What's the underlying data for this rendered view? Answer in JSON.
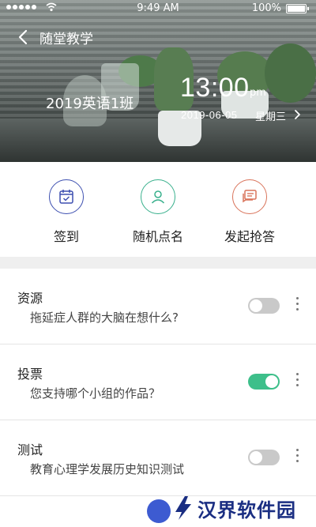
{
  "status_bar": {
    "time": "9:49 AM",
    "battery": "100%"
  },
  "nav": {
    "title": "随堂教学"
  },
  "hero": {
    "class_name": "2019英语1班",
    "time": "13:00",
    "ampm": "pm",
    "date": "2019-06-05",
    "weekday": "星期三"
  },
  "actions": [
    {
      "label": "签到",
      "icon": "calendar-check-icon",
      "color": "#3d4fb0"
    },
    {
      "label": "随机点名",
      "icon": "user-icon",
      "color": "#38b08c"
    },
    {
      "label": "发起抢答",
      "icon": "chat-icon",
      "color": "#d9735a"
    }
  ],
  "list": [
    {
      "title": "资源",
      "subtitle": "拖延症人群的大脑在想什么?",
      "toggle_on": false
    },
    {
      "title": "投票",
      "subtitle": "您支持哪个小组的作品？",
      "toggle_on": true
    },
    {
      "title": "测试",
      "subtitle": "教育心理学发展历史知识测试",
      "toggle_on": false
    }
  ],
  "colors": {
    "toggle_on": "#3dbf8a",
    "toggle_off": "#c9c9c9"
  },
  "watermark": {
    "text": "汉界软件园"
  }
}
